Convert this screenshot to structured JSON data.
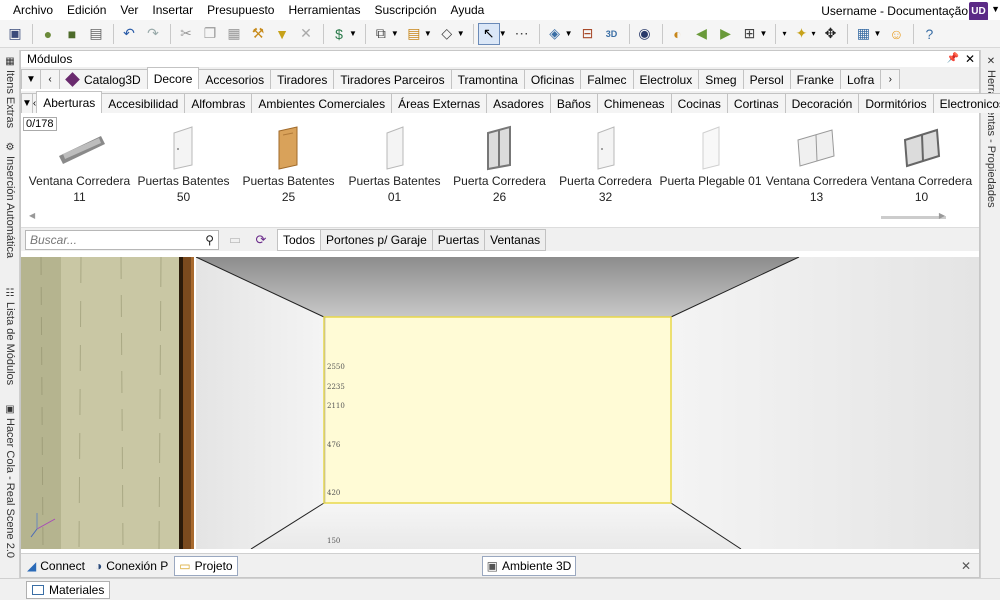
{
  "menu": {
    "items": [
      "Archivo",
      "Edición",
      "Ver",
      "Insertar",
      "Presupuesto",
      "Herramientas",
      "Suscripción",
      "Ayuda"
    ],
    "user": "Username - Documentação",
    "user_badge": "UD"
  },
  "left_tabs": [
    "Itens Extras",
    "Inserción Automática",
    "Lista de Módulos",
    "Hacer Cola - Real Scene 2.0"
  ],
  "right_tabs": [
    "Herramientas - Propiedades"
  ],
  "panel": {
    "title": "Módulos",
    "catalog_tabs": [
      "Catalog3D",
      "Decore",
      "Accesorios",
      "Tiradores",
      "Tiradores Parceiros",
      "Tramontina",
      "Oficinas",
      "Falmec",
      "Electrolux",
      "Smeg",
      "Persol",
      "Franke",
      "Lofra"
    ],
    "active_catalog": "Decore",
    "category_tabs": [
      "Aberturas",
      "Accesibilidad",
      "Alfombras",
      "Ambientes Comerciales",
      "Áreas Externas",
      "Asadores",
      "Baños",
      "Chimeneas",
      "Cocinas",
      "Cortinas",
      "Decoración",
      "Dormitórios",
      "Electronicos"
    ],
    "active_category": "Aberturas",
    "counter": "0/178",
    "items": [
      {
        "name": "Ventana Corredera 11",
        "icon": "window-icon"
      },
      {
        "name": "Puertas Batentes 50",
        "icon": "door-white-icon"
      },
      {
        "name": "Puertas Batentes 25",
        "icon": "door-wood-icon"
      },
      {
        "name": "Puertas Batentes 01",
        "icon": "door-white-icon"
      },
      {
        "name": "Puerta Corredera 26",
        "icon": "sliding-door-icon"
      },
      {
        "name": "Puerta Corredera 32",
        "icon": "door-white-icon"
      },
      {
        "name": "Puerta Plegable 01",
        "icon": "door-white-icon"
      },
      {
        "name": "Ventana Corredera 13",
        "icon": "window-icon"
      },
      {
        "name": "Ventana Corredera 10",
        "icon": "window-icon"
      }
    ],
    "search_placeholder": "Buscar...",
    "filters": [
      "Todos",
      "Portones p/ Garaje",
      "Puertas",
      "Ventanas"
    ],
    "active_filter": "Todos"
  },
  "viewport": {
    "ruler_labels": [
      "2550",
      "2235",
      "2110",
      "476",
      "420",
      "150"
    ],
    "wall_color": "#fffbd6",
    "wall_border": "#e8d84a"
  },
  "bottom_tabs": [
    "Connect",
    "Conexión P",
    "Projeto"
  ],
  "active_bottom_tab": "Projeto",
  "view_tab": "Ambiente 3D",
  "status": {
    "materials": "Materiales"
  }
}
